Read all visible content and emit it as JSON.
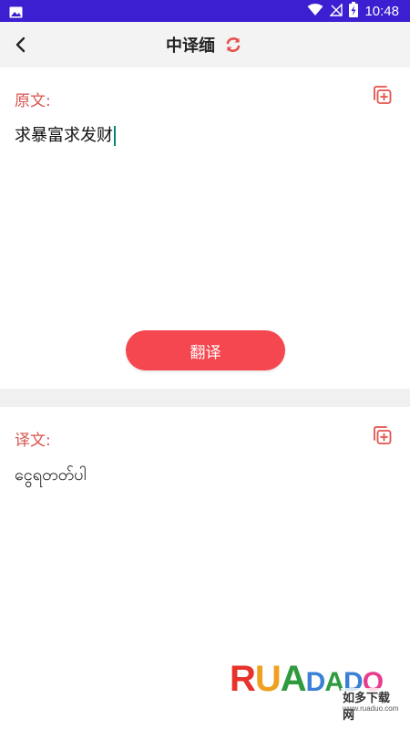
{
  "status_bar": {
    "time": "10:48",
    "icons": [
      "image-icon",
      "wifi-icon",
      "no-signal-icon",
      "battery-charging-icon"
    ]
  },
  "header": {
    "title": "中译缅",
    "back_icon": "chevron-left-icon",
    "swap_icon": "refresh-icon"
  },
  "source": {
    "label": "原文:",
    "text": "求暴富求发财",
    "copy_icon": "copy-add-icon"
  },
  "translate_button": {
    "label": "翻译"
  },
  "result": {
    "label": "译文:",
    "text": "ငွေရတတ်ပါ",
    "copy_icon": "copy-add-icon"
  },
  "watermark": {
    "brand_letters": [
      "R",
      "U",
      "A",
      "D",
      "A",
      "D",
      "O"
    ],
    "subtitle": "如多下载网",
    "url": "www.ruaduo.com"
  },
  "colors": {
    "status_bar": "#3b1fd0",
    "accent": "#f4474f",
    "label": "#d9534f",
    "header_bg": "#f3f3f3",
    "divider_bg": "#f0f0f0"
  }
}
